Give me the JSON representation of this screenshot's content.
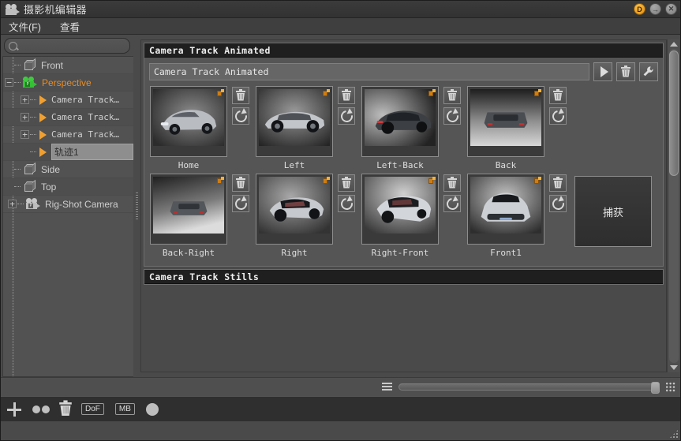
{
  "window": {
    "title": "摄影机编辑器",
    "icon": "movie-camera-icon",
    "buttons": [
      {
        "name": "dock-button",
        "label": "D",
        "color": "#e08a10"
      },
      {
        "name": "popout-button",
        "label": "→",
        "color": "#8d8d8d"
      },
      {
        "name": "close-button",
        "label": "✕",
        "color": "#8d8d8d"
      }
    ]
  },
  "menubar": {
    "items": [
      {
        "name": "menu-file",
        "label": "文件(F)"
      },
      {
        "name": "menu-view",
        "label": "查看"
      }
    ]
  },
  "search": {
    "value": "",
    "placeholder": "",
    "icon": "search-icon"
  },
  "tree": {
    "items": [
      {
        "label": "Front",
        "icon": "cube-icon",
        "indent": 1,
        "expander": "none",
        "selected": false,
        "color": "#cfcfcf"
      },
      {
        "label": "Perspective",
        "icon": "camera-green-icon",
        "indent": 1,
        "expander": "minus",
        "selected": false,
        "color": "#e78c27"
      },
      {
        "label": "Camera Track…",
        "icon": "play-triangle-icon",
        "indent": 2,
        "expander": "plus",
        "selected": false,
        "color": "#cfcfcf"
      },
      {
        "label": "Camera Track…",
        "icon": "play-triangle-icon",
        "indent": 2,
        "expander": "plus",
        "selected": false,
        "color": "#cfcfcf"
      },
      {
        "label": "Camera Track…",
        "icon": "play-triangle-icon",
        "indent": 2,
        "expander": "plus",
        "selected": false,
        "color": "#cfcfcf"
      },
      {
        "label": "轨迹1",
        "icon": "play-triangle-icon",
        "indent": 2,
        "expander": "none",
        "selected": true,
        "color": "#2f2f2f"
      },
      {
        "label": "Side",
        "icon": "cube-icon",
        "indent": 1,
        "expander": "none",
        "selected": false,
        "color": "#cfcfcf"
      },
      {
        "label": "Top",
        "icon": "cube-icon",
        "indent": 1,
        "expander": "none",
        "selected": false,
        "color": "#cfcfcf"
      },
      {
        "label": "Rig-Shot Camera",
        "icon": "camera-grey-icon",
        "indent": 0,
        "expander": "plus",
        "selected": false,
        "color": "#cfcfcf"
      }
    ]
  },
  "main": {
    "group_animated": {
      "header": "Camera Track Animated",
      "name_value": "Camera Track Animated",
      "actions": [
        {
          "name": "play-button",
          "icon": "play-icon"
        },
        {
          "name": "delete-track-button",
          "icon": "trash-icon"
        },
        {
          "name": "settings-button",
          "icon": "wrench-icon"
        }
      ],
      "shots": [
        {
          "label": "Home",
          "pinned": true
        },
        {
          "label": "Left",
          "pinned": true
        },
        {
          "label": "Left-Back",
          "pinned": true
        },
        {
          "label": "Back",
          "pinned": true
        },
        {
          "label": "Back-Right",
          "pinned": true
        },
        {
          "label": "Right",
          "pinned": true
        },
        {
          "label": "Right-Front",
          "pinned": true
        },
        {
          "label": "Front1",
          "pinned": true
        }
      ],
      "shot_buttons": [
        {
          "name": "delete-shot-button",
          "icon": "trash-icon"
        },
        {
          "name": "update-shot-button",
          "icon": "refresh-icon"
        }
      ],
      "capture_label": "捕获"
    },
    "group_stills": {
      "header": "Camera Track Stills"
    }
  },
  "scrollbar": {
    "up": "▲",
    "down": "▼"
  },
  "bottombar_top": {
    "list_icon": "list-icon",
    "grid_icon": "grid-icon",
    "slider_value": 100
  },
  "bottombar": {
    "items": [
      {
        "name": "add-camera-button",
        "icon": "plus-icon",
        "label": ""
      },
      {
        "name": "duplicate-button",
        "icon": "two-dots-icon",
        "label": ""
      },
      {
        "name": "delete-button",
        "icon": "trash-icon",
        "label": ""
      },
      {
        "name": "dof-button",
        "icon": "text-badge",
        "label": "DoF"
      },
      {
        "name": "motion-blur-button",
        "icon": "text-badge",
        "label": "MB"
      },
      {
        "name": "record-button",
        "icon": "circle-icon",
        "label": ""
      }
    ]
  }
}
